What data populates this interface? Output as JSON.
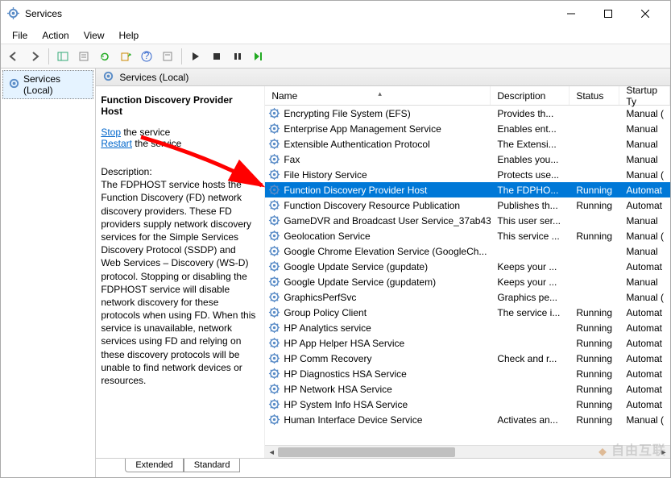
{
  "window": {
    "title": "Services"
  },
  "menu": {
    "file": "File",
    "action": "Action",
    "view": "View",
    "help": "Help"
  },
  "tree": {
    "root": "Services (Local)"
  },
  "rightheader": "Services (Local)",
  "detail": {
    "serviceName": "Function Discovery Provider Host",
    "stop": "Stop",
    "stop_suffix": " the service",
    "restart": "Restart",
    "restart_suffix": " the service",
    "descLabel": "Description:",
    "descText": "The FDPHOST service hosts the Function Discovery (FD) network discovery providers. These FD providers supply network discovery services for the Simple Services Discovery Protocol (SSDP) and Web Services – Discovery (WS-D) protocol. Stopping or disabling the FDPHOST service will disable network discovery for these protocols when using FD. When this service is unavailable, network services using FD and relying on these discovery protocols will be unable to find network devices or resources."
  },
  "columns": {
    "name": "Name",
    "description": "Description",
    "status": "Status",
    "startup": "Startup Ty"
  },
  "tabs": {
    "extended": "Extended",
    "standard": "Standard"
  },
  "services": [
    {
      "name": "Encrypting File System (EFS)",
      "desc": "Provides th...",
      "status": "",
      "startup": "Manual ("
    },
    {
      "name": "Enterprise App Management Service",
      "desc": "Enables ent...",
      "status": "",
      "startup": "Manual"
    },
    {
      "name": "Extensible Authentication Protocol",
      "desc": "The Extensi...",
      "status": "",
      "startup": "Manual"
    },
    {
      "name": "Fax",
      "desc": "Enables you...",
      "status": "",
      "startup": "Manual"
    },
    {
      "name": "File History Service",
      "desc": "Protects use...",
      "status": "",
      "startup": "Manual ("
    },
    {
      "name": "Function Discovery Provider Host",
      "desc": "The FDPHO...",
      "status": "Running",
      "startup": "Automat",
      "selected": true
    },
    {
      "name": "Function Discovery Resource Publication",
      "desc": "Publishes th...",
      "status": "Running",
      "startup": "Automat"
    },
    {
      "name": "GameDVR and Broadcast User Service_37ab43",
      "desc": "This user ser...",
      "status": "",
      "startup": "Manual"
    },
    {
      "name": "Geolocation Service",
      "desc": "This service ...",
      "status": "Running",
      "startup": "Manual ("
    },
    {
      "name": "Google Chrome Elevation Service (GoogleCh...",
      "desc": "",
      "status": "",
      "startup": "Manual"
    },
    {
      "name": "Google Update Service (gupdate)",
      "desc": "Keeps your ...",
      "status": "",
      "startup": "Automat"
    },
    {
      "name": "Google Update Service (gupdatem)",
      "desc": "Keeps your ...",
      "status": "",
      "startup": "Manual"
    },
    {
      "name": "GraphicsPerfSvc",
      "desc": "Graphics pe...",
      "status": "",
      "startup": "Manual ("
    },
    {
      "name": "Group Policy Client",
      "desc": "The service i...",
      "status": "Running",
      "startup": "Automat"
    },
    {
      "name": "HP Analytics service",
      "desc": "",
      "status": "Running",
      "startup": "Automat"
    },
    {
      "name": "HP App Helper HSA Service",
      "desc": "",
      "status": "Running",
      "startup": "Automat"
    },
    {
      "name": "HP Comm Recovery",
      "desc": "Check and r...",
      "status": "Running",
      "startup": "Automat"
    },
    {
      "name": "HP Diagnostics HSA Service",
      "desc": "",
      "status": "Running",
      "startup": "Automat"
    },
    {
      "name": "HP Network HSA Service",
      "desc": "",
      "status": "Running",
      "startup": "Automat"
    },
    {
      "name": "HP System Info HSA Service",
      "desc": "",
      "status": "Running",
      "startup": "Automat"
    },
    {
      "name": "Human Interface Device Service",
      "desc": "Activates an...",
      "status": "Running",
      "startup": "Manual ("
    }
  ]
}
